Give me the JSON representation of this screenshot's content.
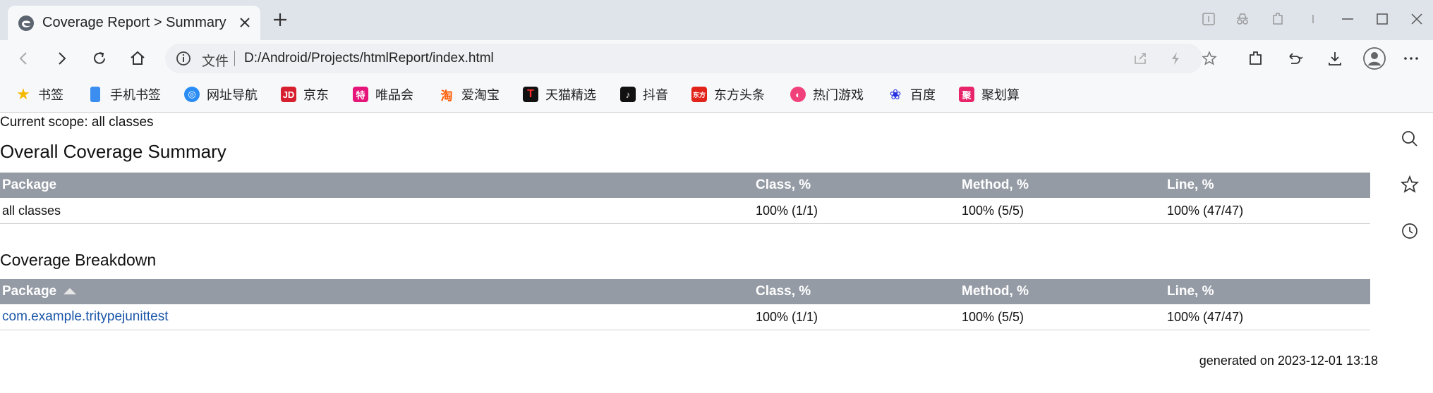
{
  "tab": {
    "title": "Coverage Report > Summary"
  },
  "address_bar": {
    "file_label": "文件",
    "url": "D:/Android/Projects/htmlReport/index.html"
  },
  "bookmarks": [
    {
      "label": "书签",
      "icon": "star-icon",
      "color": "#f5b800",
      "glyph": "★"
    },
    {
      "label": "手机书签",
      "icon": "phone-icon",
      "color": "#3b8ef0",
      "glyph": ""
    },
    {
      "label": "网址导航",
      "icon": "nav-icon",
      "color": "#2a8cf5",
      "glyph": "◎"
    },
    {
      "label": "京东",
      "icon": "jd-icon",
      "color": "#d6202f",
      "glyph": "JD"
    },
    {
      "label": "唯品会",
      "icon": "vip-icon",
      "color": "#e5157a",
      "glyph": "特"
    },
    {
      "label": "爱淘宝",
      "icon": "taobao-icon",
      "color": "#ff5a00",
      "glyph": "淘"
    },
    {
      "label": "天猫精选",
      "icon": "tmall-icon",
      "color": "#e0002a",
      "glyph": "T"
    },
    {
      "label": "抖音",
      "icon": "douyin-icon",
      "color": "#111111",
      "glyph": "♪"
    },
    {
      "label": "东方头条",
      "icon": "dongfang-icon",
      "color": "#e2231a",
      "glyph": "东方"
    },
    {
      "label": "热门游戏",
      "icon": "game-icon",
      "color": "#f0417a",
      "glyph": "◐"
    },
    {
      "label": "百度",
      "icon": "baidu-icon",
      "color": "#2932e1",
      "glyph": "❀"
    },
    {
      "label": "聚划算",
      "icon": "juhuasuan-icon",
      "color": "#e8246b",
      "glyph": "聚"
    }
  ],
  "report": {
    "scope": "Current scope: all classes",
    "overall_title": "Overall Coverage Summary",
    "breakdown_title": "Coverage Breakdown",
    "columns": [
      "Package",
      "Class, %",
      "Method, %",
      "Line, %"
    ],
    "overall_rows": [
      {
        "package": "all classes",
        "class": "100% (1/1)",
        "method": "100% (5/5)",
        "line": "100% (47/47)"
      }
    ],
    "breakdown_rows": [
      {
        "package": "com.example.tritypejunittest",
        "class": "100% (1/1)",
        "method": "100% (5/5)",
        "line": "100% (47/47)"
      }
    ],
    "generated": "generated on 2023-12-01 13:18"
  },
  "colors": {
    "header_bg": "#959ba5",
    "link": "#1a56a8",
    "tabstrip": "#dfe3ea"
  }
}
